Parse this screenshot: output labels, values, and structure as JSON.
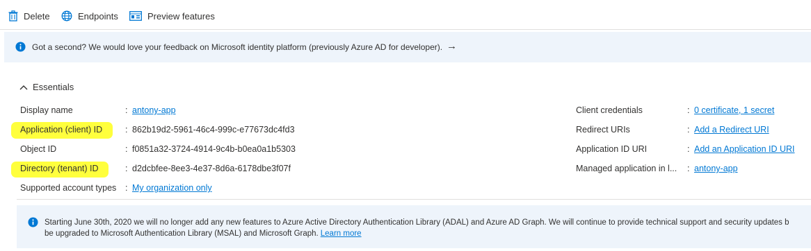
{
  "toolbar": {
    "delete_label": "Delete",
    "endpoints_label": "Endpoints",
    "preview_label": "Preview features"
  },
  "feedback_banner": {
    "text": "Got a second? We would love your feedback on Microsoft identity platform (previously Azure AD for developer).",
    "arrow": "→"
  },
  "essentials": {
    "header": "Essentials",
    "left": [
      {
        "label": "Display name",
        "value": "antony-app"
      },
      {
        "label": "Application (client) ID",
        "value": "862b19d2-5961-46c4-999c-e77673dc4fd3"
      },
      {
        "label": "Object ID",
        "value": "f0851a32-3724-4914-9c4b-b0ea0a1b5303"
      },
      {
        "label": "Directory (tenant) ID",
        "value": "d2dcbfee-8ee3-4e37-8d6a-6178dbe3f07f"
      },
      {
        "label": "Supported account types",
        "value": "My organization only"
      }
    ],
    "right": [
      {
        "label": "Client credentials",
        "value": "0 certificate, 1 secret"
      },
      {
        "label": "Redirect URIs",
        "value": "Add a Redirect URI"
      },
      {
        "label": "Application ID URI",
        "value": "Add an Application ID URI"
      },
      {
        "label": "Managed application in l...",
        "value": "antony-app"
      }
    ],
    "colon": ":"
  },
  "adal_banner": {
    "line1": "Starting June 30th, 2020 we will no longer add any new features to Azure Active Directory Authentication Library (ADAL) and Azure AD Graph. We will continue to provide technical support and security updates b",
    "line2": "be upgraded to Microsoft Authentication Library (MSAL) and Microsoft Graph.",
    "learn_more": "Learn more"
  },
  "colors": {
    "accent": "#0078d4",
    "banner_bg": "#eef4fb",
    "highlight": "#ffff33"
  }
}
